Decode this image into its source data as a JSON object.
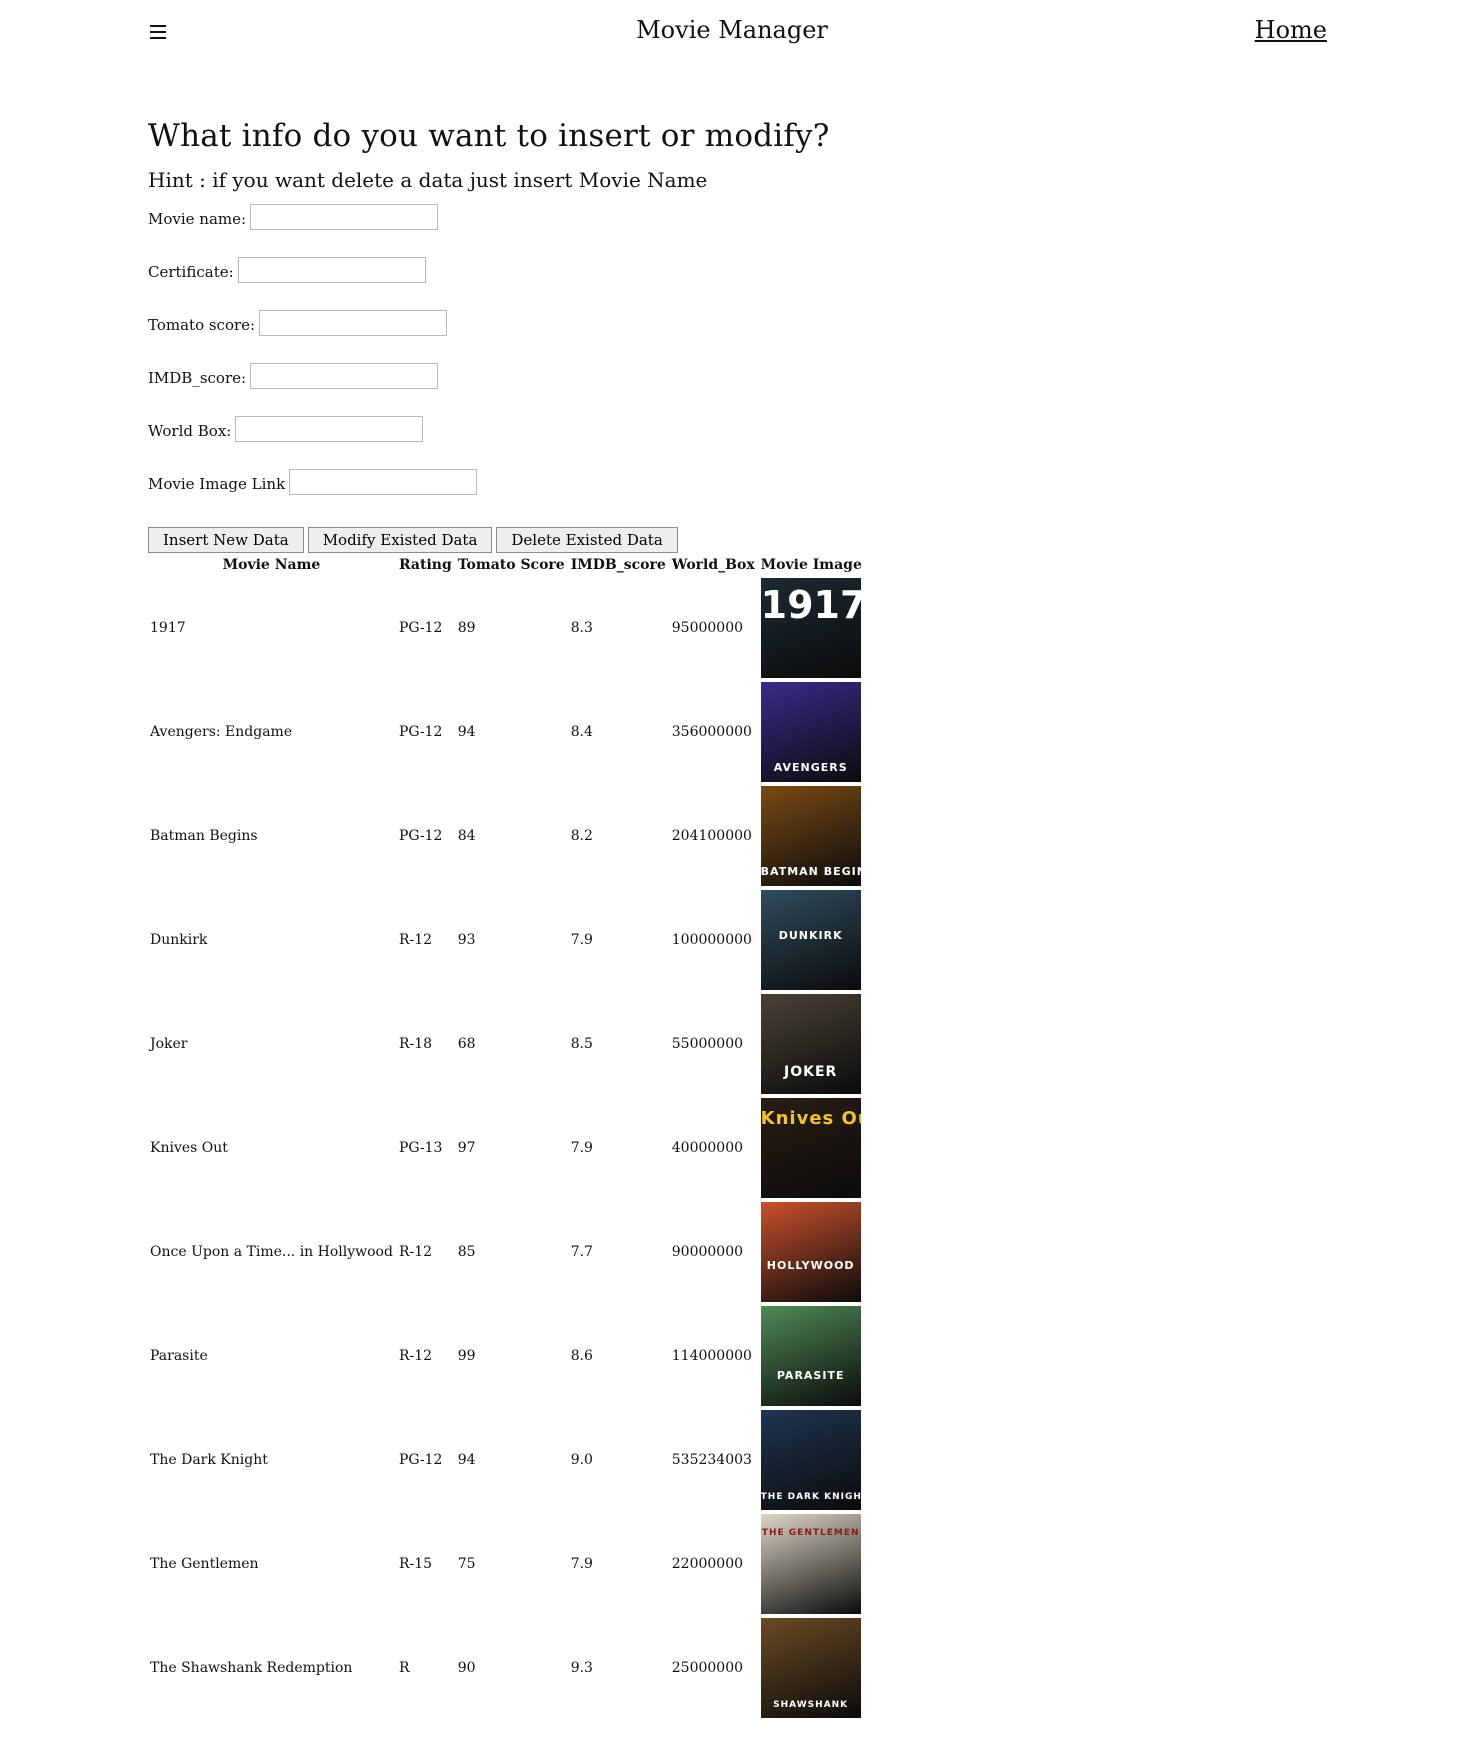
{
  "header": {
    "menu_icon": "hamburger-menu-icon",
    "title": "Movie Manager",
    "home_link": "Home"
  },
  "form": {
    "heading": "What info do you want to insert or modify?",
    "hint": "Hint : if you want delete a data just insert Movie Name",
    "fields": {
      "movie_name": {
        "label": "Movie name:",
        "value": ""
      },
      "certificate": {
        "label": "Certificate:",
        "value": ""
      },
      "tomato_score": {
        "label": "Tomato score:",
        "value": ""
      },
      "imdb_score": {
        "label": "IMDB_score:",
        "value": ""
      },
      "world_box": {
        "label": "World Box:",
        "value": ""
      },
      "image_link": {
        "label": "Movie Image Link",
        "value": ""
      }
    },
    "buttons": {
      "insert": "Insert New Data",
      "modify": "Modify Existed Data",
      "delete": "Delete Existed Data"
    }
  },
  "table": {
    "headers": [
      "Movie Name",
      "Rating",
      "Tomato Score",
      "IMDB_score",
      "World_Box",
      "Movie Image"
    ],
    "rows": [
      {
        "name": "1917",
        "rating": "PG-12",
        "tomato": "89",
        "imdb": "8.3",
        "box": "95000000",
        "poster_text": "1917",
        "poster_color": "#1b2a34"
      },
      {
        "name": "Avengers: Endgame",
        "rating": "PG-12",
        "tomato": "94",
        "imdb": "8.4",
        "box": "356000000",
        "poster_text": "AVENGERS",
        "poster_color": "#3b2a8c"
      },
      {
        "name": "Batman Begins",
        "rating": "PG-12",
        "tomato": "84",
        "imdb": "8.2",
        "box": "204100000",
        "poster_text": "BATMAN BEGINS",
        "poster_color": "#7a4a14"
      },
      {
        "name": "Dunkirk",
        "rating": "R-12",
        "tomato": "93",
        "imdb": "7.9",
        "box": "100000000",
        "poster_text": "DUNKIRK",
        "poster_color": "#2f4c5e"
      },
      {
        "name": "Joker",
        "rating": "R-18",
        "tomato": "68",
        "imdb": "8.5",
        "box": "55000000",
        "poster_text": "JOKER",
        "poster_color": "#4a4236"
      },
      {
        "name": "Knives Out",
        "rating": "PG-13",
        "tomato": "97",
        "imdb": "7.9",
        "box": "40000000",
        "poster_text": "Knives Out",
        "poster_color": "#2a1d14"
      },
      {
        "name": "Once Upon a Time... in Hollywood",
        "rating": "R-12",
        "tomato": "85",
        "imdb": "7.7",
        "box": "90000000",
        "poster_text": "HOLLYWOOD",
        "poster_color": "#c9512c"
      },
      {
        "name": "Parasite",
        "rating": "R-12",
        "tomato": "99",
        "imdb": "8.6",
        "box": "114000000",
        "poster_text": "PARASITE",
        "poster_color": "#4f8a56"
      },
      {
        "name": "The Dark Knight",
        "rating": "PG-12",
        "tomato": "94",
        "imdb": "9.0",
        "box": "535234003",
        "poster_text": "THE DARK KNIGHT",
        "poster_color": "#1f3552"
      },
      {
        "name": "The Gentlemen",
        "rating": "R-15",
        "tomato": "75",
        "imdb": "7.9",
        "box": "22000000",
        "poster_text": "THE GENTLEMEN",
        "poster_color": "#ded6c6"
      },
      {
        "name": "The Shawshank Redemption",
        "rating": "R",
        "tomato": "90",
        "imdb": "9.3",
        "box": "25000000",
        "poster_text": "SHAWSHANK",
        "poster_color": "#6b4a22"
      }
    ]
  }
}
